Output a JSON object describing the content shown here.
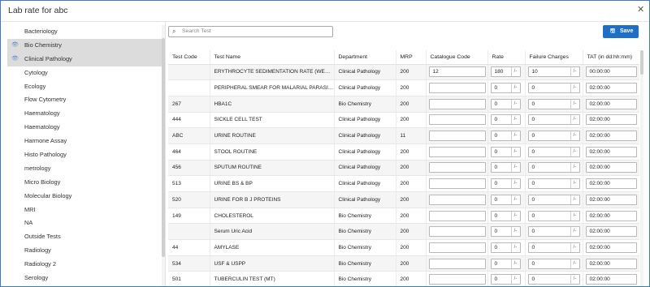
{
  "title": "Lab rate for abc",
  "close_icon": "close-icon",
  "search": {
    "placeholder": "Search Test"
  },
  "save_label": "Save",
  "sidebar": {
    "items": [
      {
        "label": "Bacteriology",
        "selected": false,
        "icon": ""
      },
      {
        "label": "Bio Chemistry",
        "selected": true,
        "icon": "eye-icon"
      },
      {
        "label": "Clinical Pathology",
        "selected": true,
        "icon": "eye-icon"
      },
      {
        "label": "Cytology",
        "selected": false,
        "icon": ""
      },
      {
        "label": "Ecology",
        "selected": false,
        "icon": ""
      },
      {
        "label": "Flow Cytometry",
        "selected": false,
        "icon": ""
      },
      {
        "label": "Haematology",
        "selected": false,
        "icon": ""
      },
      {
        "label": "Haematology",
        "selected": false,
        "icon": ""
      },
      {
        "label": "Harmone Assay",
        "selected": false,
        "icon": ""
      },
      {
        "label": "Histo Pathology",
        "selected": false,
        "icon": ""
      },
      {
        "label": "metrology",
        "selected": false,
        "icon": ""
      },
      {
        "label": "Micro Biology",
        "selected": false,
        "icon": ""
      },
      {
        "label": "Molecular Biology",
        "selected": false,
        "icon": ""
      },
      {
        "label": "MRI",
        "selected": false,
        "icon": ""
      },
      {
        "label": "NA",
        "selected": false,
        "icon": ""
      },
      {
        "label": "Outside Tests",
        "selected": false,
        "icon": ""
      },
      {
        "label": "Radiology",
        "selected": false,
        "icon": ""
      },
      {
        "label": "Radiology 2",
        "selected": false,
        "icon": ""
      },
      {
        "label": "Serology",
        "selected": false,
        "icon": ""
      }
    ]
  },
  "table": {
    "columns": [
      "Test Code",
      "Test Name",
      "Department",
      "MRP",
      "Catalogue Code",
      "Rate",
      "Failure Charges",
      "TAT (in dd:hh:mm)"
    ],
    "rate_suffix": "/-",
    "rows": [
      {
        "code": "",
        "name": "ERYTHROCYTE SEDIMENTATION RATE (WESTERGREN)",
        "department": "Clinical Pathology",
        "mrp": "200",
        "catalogue": "12",
        "rate": "180",
        "failure": "10",
        "tat": "00:00:00"
      },
      {
        "code": "",
        "name": "PERIPHERAL SMEAR FOR MALARIAL PARASITE",
        "department": "Clinical Pathology",
        "mrp": "200",
        "catalogue": "",
        "rate": "0",
        "failure": "0",
        "tat": "02:00:00"
      },
      {
        "code": "267",
        "name": "HBA1C",
        "department": "Bio Chemistry",
        "mrp": "200",
        "catalogue": "",
        "rate": "0",
        "failure": "0",
        "tat": "02:00:00"
      },
      {
        "code": "444",
        "name": "SICKLE CELL TEST",
        "department": "Clinical Pathology",
        "mrp": "200",
        "catalogue": "",
        "rate": "0",
        "failure": "0",
        "tat": "02:00:00"
      },
      {
        "code": "ABC",
        "name": "URINE ROUTINE",
        "department": "Clinical Pathology",
        "mrp": "11",
        "catalogue": "",
        "rate": "0",
        "failure": "0",
        "tat": "02:00:00"
      },
      {
        "code": "464",
        "name": "STOOL ROUTINE",
        "department": "Clinical Pathology",
        "mrp": "200",
        "catalogue": "",
        "rate": "0",
        "failure": "0",
        "tat": "02:00:00"
      },
      {
        "code": "456",
        "name": "SPUTUM ROUTINE",
        "department": "Clinical Pathology",
        "mrp": "200",
        "catalogue": "",
        "rate": "0",
        "failure": "0",
        "tat": "02:00:00"
      },
      {
        "code": "513",
        "name": "URINE BS & BP",
        "department": "Clinical Pathology",
        "mrp": "200",
        "catalogue": "",
        "rate": "0",
        "failure": "0",
        "tat": "02:00:00"
      },
      {
        "code": "520",
        "name": "URINE FOR B J PROTEINS",
        "department": "Clinical Pathology",
        "mrp": "200",
        "catalogue": "",
        "rate": "0",
        "failure": "0",
        "tat": "02:00:00"
      },
      {
        "code": "149",
        "name": "CHOLESTEROL",
        "department": "Bio Chemistry",
        "mrp": "200",
        "catalogue": "",
        "rate": "0",
        "failure": "0",
        "tat": "02:00:00"
      },
      {
        "code": "",
        "name": "Serum Uric Acid",
        "department": "Bio Chemistry",
        "mrp": "200",
        "catalogue": "",
        "rate": "0",
        "failure": "0",
        "tat": "02:00:00"
      },
      {
        "code": "44",
        "name": "AMYLASE",
        "department": "Bio Chemistry",
        "mrp": "200",
        "catalogue": "",
        "rate": "0",
        "failure": "0",
        "tat": "02:00:00"
      },
      {
        "code": "534",
        "name": "USF & USPP",
        "department": "Bio Chemistry",
        "mrp": "200",
        "catalogue": "",
        "rate": "0",
        "failure": "0",
        "tat": "02:00:00"
      },
      {
        "code": "501",
        "name": "TUBERCULIN TEST (MT)",
        "department": "Bio Chemistry",
        "mrp": "200",
        "catalogue": "",
        "rate": "0",
        "failure": "0",
        "tat": "02:00:00"
      }
    ]
  },
  "colors": {
    "accent": "#1f6fc5",
    "border": "#3a78c9",
    "selected_bg": "#dcdcdc"
  }
}
